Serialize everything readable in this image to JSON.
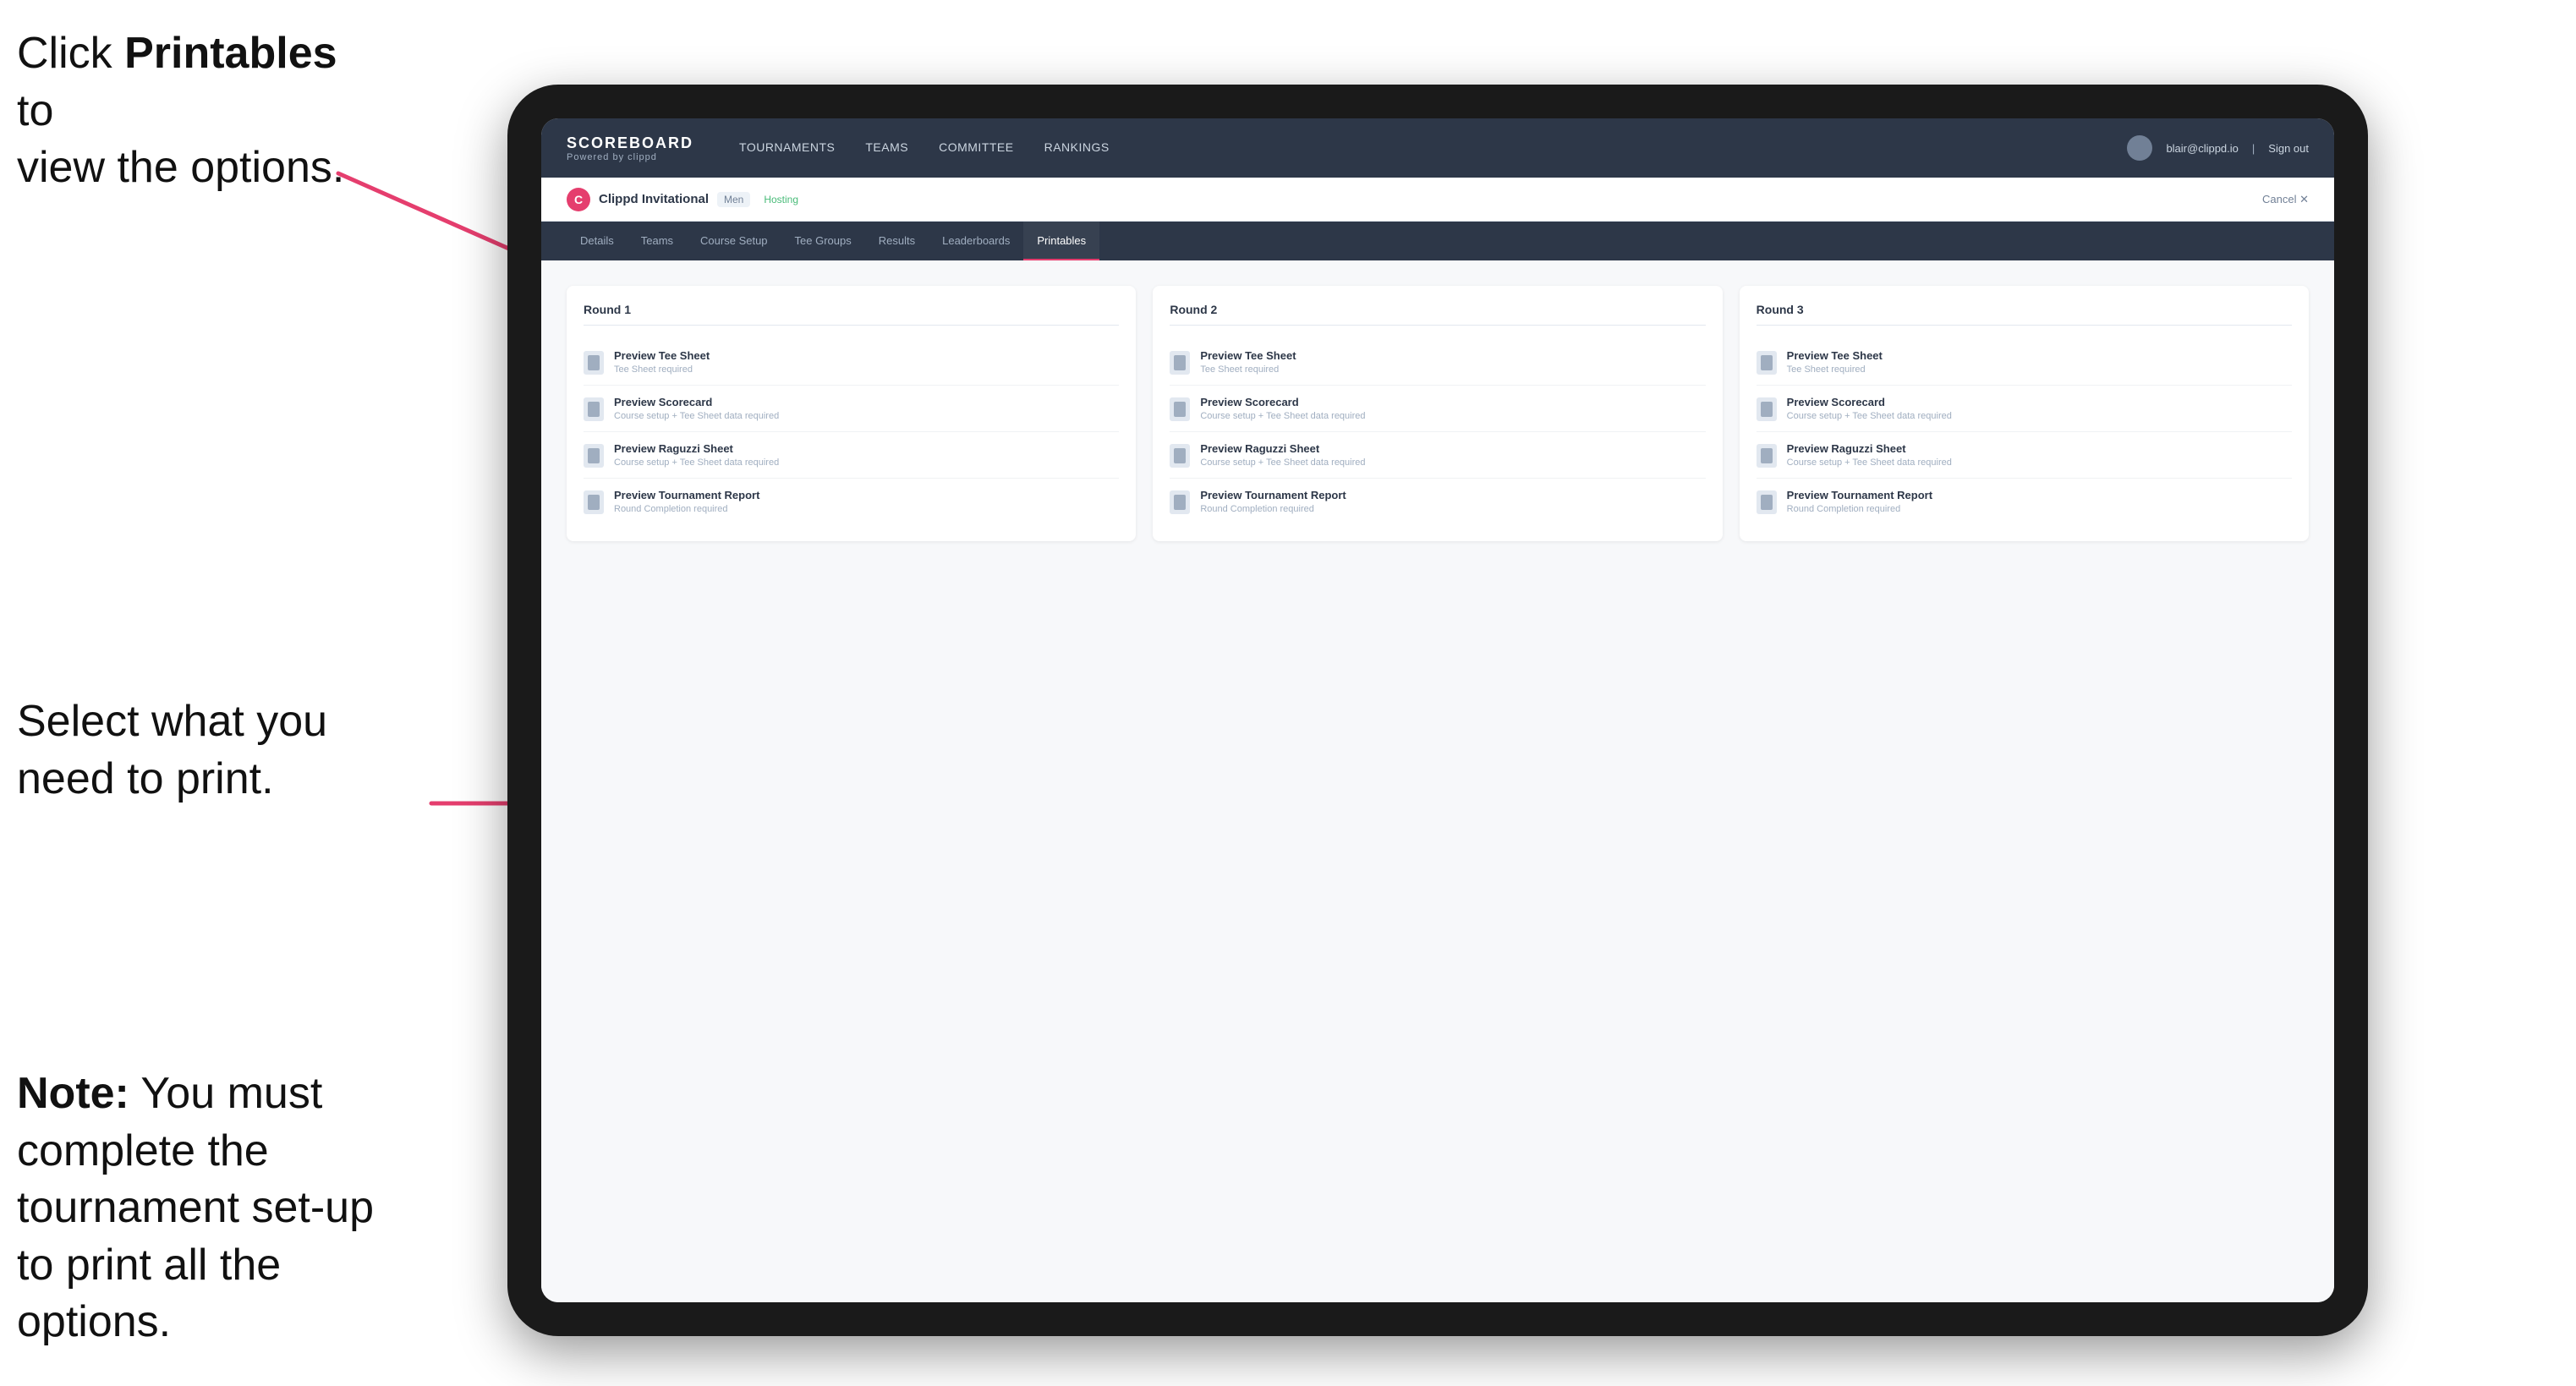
{
  "instructions": {
    "top": {
      "text_1": "Click ",
      "bold": "Printables",
      "text_2": " to",
      "line2": "view the options."
    },
    "middle": {
      "line1": "Select what you",
      "line2": "need to print."
    },
    "bottom": {
      "bold": "Note:",
      "text": " You must complete the tournament set-up to print all the options."
    }
  },
  "top_nav": {
    "logo": "SCOREBOARD",
    "logo_sub": "Powered by clippd",
    "links": [
      {
        "label": "TOURNAMENTS",
        "active": false
      },
      {
        "label": "TEAMS",
        "active": false
      },
      {
        "label": "COMMITTEE",
        "active": false
      },
      {
        "label": "RANKINGS",
        "active": false
      }
    ],
    "user_email": "blair@clippd.io",
    "sign_out": "Sign out"
  },
  "sub_nav": {
    "tournament": "Clippd Invitational",
    "division": "Men",
    "status": "Hosting",
    "cancel": "Cancel ✕"
  },
  "tabs": [
    {
      "label": "Details",
      "active": false
    },
    {
      "label": "Teams",
      "active": false
    },
    {
      "label": "Course Setup",
      "active": false
    },
    {
      "label": "Tee Groups",
      "active": false
    },
    {
      "label": "Results",
      "active": false
    },
    {
      "label": "Leaderboards",
      "active": false
    },
    {
      "label": "Printables",
      "active": true
    }
  ],
  "rounds": [
    {
      "title": "Round 1",
      "items": [
        {
          "title": "Preview Tee Sheet",
          "sub": "Tee Sheet required"
        },
        {
          "title": "Preview Scorecard",
          "sub": "Course setup + Tee Sheet data required"
        },
        {
          "title": "Preview Raguzzi Sheet",
          "sub": "Course setup + Tee Sheet data required"
        },
        {
          "title": "Preview Tournament Report",
          "sub": "Round Completion required"
        }
      ]
    },
    {
      "title": "Round 2",
      "items": [
        {
          "title": "Preview Tee Sheet",
          "sub": "Tee Sheet required"
        },
        {
          "title": "Preview Scorecard",
          "sub": "Course setup + Tee Sheet data required"
        },
        {
          "title": "Preview Raguzzi Sheet",
          "sub": "Course setup + Tee Sheet data required"
        },
        {
          "title": "Preview Tournament Report",
          "sub": "Round Completion required"
        }
      ]
    },
    {
      "title": "Round 3",
      "items": [
        {
          "title": "Preview Tee Sheet",
          "sub": "Tee Sheet required"
        },
        {
          "title": "Preview Scorecard",
          "sub": "Course setup + Tee Sheet data required"
        },
        {
          "title": "Preview Raguzzi Sheet",
          "sub": "Course setup + Tee Sheet data required"
        },
        {
          "title": "Preview Tournament Report",
          "sub": "Round Completion required"
        }
      ]
    }
  ]
}
